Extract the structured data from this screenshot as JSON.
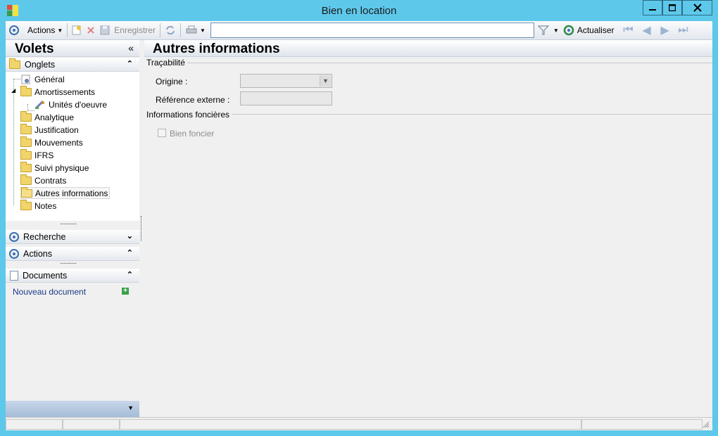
{
  "window": {
    "title": "Bien en location",
    "controls": [
      "minimize",
      "maximize",
      "close"
    ]
  },
  "toolbar": {
    "actions_label": "Actions",
    "save_label": "Enregistrer",
    "search_value": "",
    "refresh_label": "Actualiser",
    "icons": [
      "circle-nav-icon",
      "new-doc-icon",
      "delete-icon",
      "save-icon",
      "refresh-icon",
      "print-icon",
      "filter-icon",
      "refresh-green-icon",
      "first-icon",
      "prev-icon",
      "next-icon",
      "last-icon"
    ]
  },
  "sidebar": {
    "title": "Volets",
    "collapse_glyph": "«",
    "sections": {
      "onglets": "Onglets",
      "recherche": "Recherche",
      "actions": "Actions",
      "documents": "Documents"
    },
    "tree": [
      {
        "label": "Général",
        "icon": "settings-icon"
      },
      {
        "label": "Amortissements",
        "icon": "folder-icon"
      },
      {
        "label": "Unités d'oeuvre",
        "icon": "tools-icon"
      },
      {
        "label": "Analytique",
        "icon": "folder-icon"
      },
      {
        "label": "Justification",
        "icon": "folder-icon"
      },
      {
        "label": "Mouvements",
        "icon": "folder-icon"
      },
      {
        "label": "IFRS",
        "icon": "folder-icon"
      },
      {
        "label": "Suivi physique",
        "icon": "folder-icon"
      },
      {
        "label": "Contrats",
        "icon": "folder-icon"
      },
      {
        "label": "Autres informations",
        "icon": "folder-open-icon",
        "selected": true
      },
      {
        "label": "Notes",
        "icon": "folder-icon"
      }
    ],
    "new_document": "Nouveau document"
  },
  "main": {
    "title": "Autres informations",
    "tracabilite": {
      "title": "Traçabilité",
      "origine_label": "Origine :",
      "origine_value": "",
      "reference_label": "Référence externe :",
      "reference_value": ""
    },
    "foncieres": {
      "title": "Informations foncières",
      "bien_foncier_label": "Bien foncier",
      "bien_foncier_checked": false
    }
  },
  "colors": {
    "titlebar": "#5ec8ea",
    "accent": "#3a6fb0",
    "link": "#1c3a8a"
  }
}
